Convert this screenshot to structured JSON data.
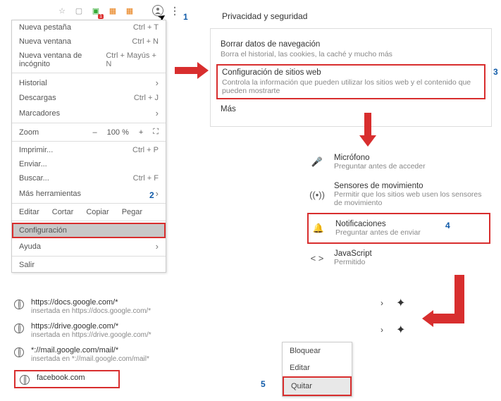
{
  "toolbar": {
    "badge": "1"
  },
  "chrome_menu": {
    "new_tab": "Nueva pestaña",
    "new_tab_sc": "Ctrl + T",
    "new_window": "Nueva ventana",
    "new_window_sc": "Ctrl + N",
    "incognito": "Nueva ventana de incógnito",
    "incognito_sc": "Ctrl + Mayús + N",
    "history": "Historial",
    "downloads": "Descargas",
    "downloads_sc": "Ctrl + J",
    "bookmarks": "Marcadores",
    "zoom": "Zoom",
    "zoom_minus": "–",
    "zoom_level": "100 %",
    "zoom_plus": "+",
    "print": "Imprimir...",
    "print_sc": "Ctrl + P",
    "send": "Enviar...",
    "find": "Buscar...",
    "find_sc": "Ctrl + F",
    "more_tools": "Más herramientas",
    "edit": "Editar",
    "cut": "Cortar",
    "copy": "Copiar",
    "paste": "Pegar",
    "settings": "Configuración",
    "help": "Ayuda",
    "exit": "Salir"
  },
  "labels": {
    "n1": "1",
    "n2": "2",
    "n3": "3",
    "n4": "4",
    "n5": "5"
  },
  "privacy": {
    "title": "Privacidad y seguridad",
    "clear_title": "Borrar datos de navegación",
    "clear_sub": "Borra el historial, las cookies, la caché y mucho más",
    "site_title": "Configuración de sitios web",
    "site_sub": "Controla la información que pueden utilizar los sitios web y el contenido que pueden mostrarte",
    "more": "Más"
  },
  "settings": {
    "mic_t": "Micrófono",
    "mic_s": "Preguntar antes de acceder",
    "motion_t": "Sensores de movimiento",
    "motion_s": "Permitir que los sitios web usen los sensores de movimiento",
    "notif_t": "Notificaciones",
    "notif_s": "Preguntar antes de enviar",
    "js_t": "JavaScript",
    "js_s": "Permitido"
  },
  "sites": {
    "docs_u": "https://docs.google.com/*",
    "docs_e": "insertada en https://docs.google.com/*",
    "drive_u": "https://drive.google.com/*",
    "drive_e": "insertada en https://drive.google.com/*",
    "mail_u": "*://mail.google.com/mail/*",
    "mail_e": "insertada en *://mail.google.com/mail*",
    "fb_u": "facebook.com"
  },
  "context": {
    "block": "Bloquear",
    "edit": "Editar",
    "remove": "Quitar"
  }
}
